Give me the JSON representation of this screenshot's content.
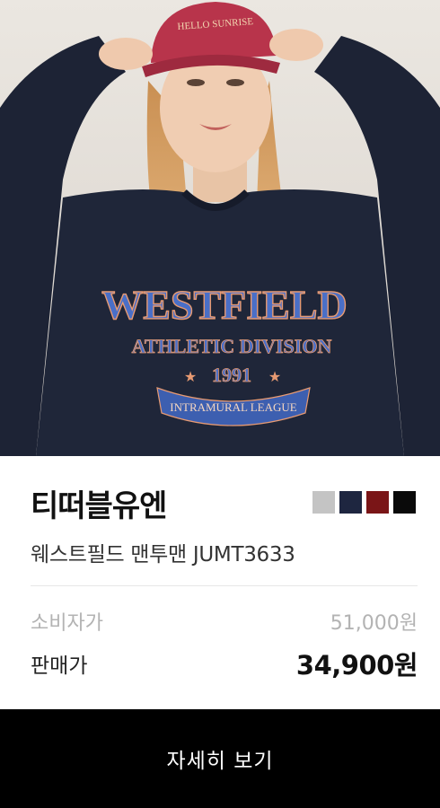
{
  "product": {
    "image_alt": "Model wearing navy sweatshirt and red cap",
    "cap_text": "HELLO SUNRISE",
    "print": {
      "line1": "WESTFIELD",
      "line2": "ATHLETIC DIVISION",
      "year": "1991",
      "banner": "INTRAMURAL LEAGUE"
    },
    "brand": "티떠블유엔",
    "name": "웨스트필드 맨투맨 JUMT3633",
    "color_options": [
      "#c4c4c4",
      "#1e2640",
      "#7a1517",
      "#0a0a0a"
    ],
    "retail_label": "소비자가",
    "retail_price": "51,000원",
    "sale_label": "판매가",
    "sale_price": "34,900원"
  },
  "cta": {
    "detail_label": "자세히 보기"
  }
}
